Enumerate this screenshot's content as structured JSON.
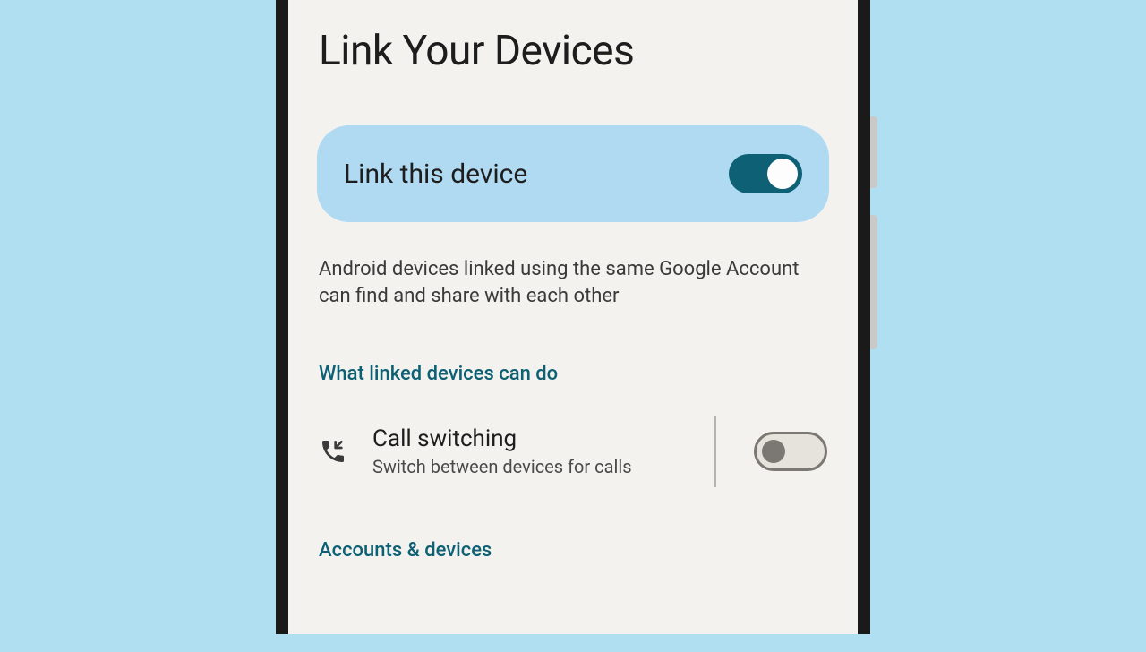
{
  "page": {
    "title": "Link Your Devices"
  },
  "primaryToggle": {
    "label": "Link this device",
    "enabled": true
  },
  "description": "Android devices linked using the same Google Account can find and share with each other",
  "sections": {
    "features": {
      "header": "What linked devices can do",
      "items": [
        {
          "icon": "phone-incoming-icon",
          "title": "Call switching",
          "subtitle": "Switch between devices for calls",
          "enabled": false
        }
      ]
    },
    "accounts": {
      "header": "Accounts & devices"
    }
  },
  "colors": {
    "background": "#b0dff2",
    "screenBg": "#f3f2ee",
    "cardBg": "#afdaf2",
    "accent": "#0e6074"
  }
}
